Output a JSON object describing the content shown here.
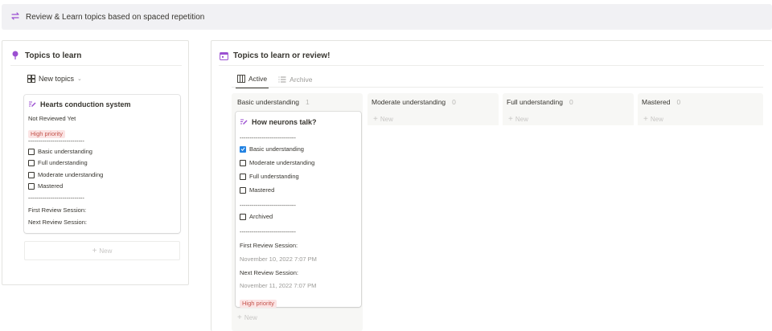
{
  "banner": {
    "title": "Review & Learn topics based on spaced repetition",
    "icon": "repeat-icon"
  },
  "left_panel": {
    "title": "Topics to learn",
    "icon": "pin-icon",
    "view": {
      "label": "New topics",
      "icon": "gallery-icon"
    },
    "card": {
      "title": "Hearts conduction system",
      "status": "Not Reviewed Yet",
      "tag": "High priority",
      "divider": "----------------------------",
      "checkboxes": [
        {
          "label": "Basic understanding",
          "checked": false
        },
        {
          "label": "Full understanding",
          "checked": false
        },
        {
          "label": "Moderate understanding",
          "checked": false
        },
        {
          "label": "Mastered",
          "checked": false
        }
      ],
      "first_review_label": "First Review Session:",
      "next_review_label": "Next Review Session:"
    },
    "new_label": "New"
  },
  "right_panel": {
    "title": "Topics to learn or review!",
    "icon": "calendar-icon",
    "tabs": [
      {
        "label": "Active",
        "active": true
      },
      {
        "label": "Archive",
        "active": false
      }
    ],
    "columns": [
      {
        "name": "Basic understanding",
        "count": "1"
      },
      {
        "name": "Moderate understanding",
        "count": "0"
      },
      {
        "name": "Full understanding",
        "count": "0"
      },
      {
        "name": "Mastered",
        "count": "0"
      }
    ],
    "card": {
      "title": "How neurons talk?",
      "divider": "----------------------------",
      "checkboxes": [
        {
          "label": "Basic understanding",
          "checked": true
        },
        {
          "label": "Moderate understanding",
          "checked": false
        },
        {
          "label": "Full understanding",
          "checked": false
        },
        {
          "label": "Mastered",
          "checked": false
        }
      ],
      "archived": {
        "label": "Archived",
        "checked": false
      },
      "first_review_label": "First Review Session:",
      "first_review_date": "November 10, 2022 7:07 PM",
      "next_review_label": "Next Review Session:",
      "next_review_date": "November 11, 2022 7:07 PM",
      "tag": "High priority"
    },
    "new_label": "New"
  },
  "colors": {
    "accent": "#2383e2",
    "tag_text": "#c4554d",
    "tag_bg": "#fbe4e4",
    "icon_purple": "#9b4fd1"
  }
}
